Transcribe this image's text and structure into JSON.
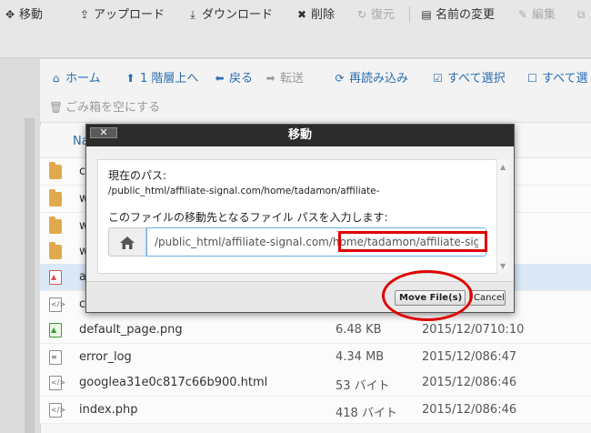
{
  "toolbar": {
    "items": [
      {
        "label": "移動",
        "icon": "move-icon",
        "glyph": "✥"
      },
      {
        "label": "アップロード",
        "icon": "upload-icon",
        "glyph": "⇪"
      },
      {
        "label": "ダウンロード",
        "icon": "download-icon",
        "glyph": "⤓"
      },
      {
        "label": "削除",
        "icon": "delete-icon",
        "glyph": "✖"
      },
      {
        "label": "復元",
        "icon": "restore-icon",
        "glyph": "↻",
        "disabled": true
      },
      {
        "label": "名前の変更",
        "icon": "rename-icon",
        "glyph": "▤"
      },
      {
        "label": "編集",
        "icon": "edit-icon",
        "glyph": "✎",
        "disabled": true
      },
      {
        "label": "",
        "icon": "overflow-icon",
        "glyph": "⧉",
        "disabled": true
      }
    ]
  },
  "subbar": {
    "items": [
      {
        "label": "ホーム",
        "icon": "home-icon",
        "glyph": "⌂"
      },
      {
        "label": "1 階層上へ",
        "icon": "level-up-icon",
        "glyph": "⬆"
      },
      {
        "label": "戻る",
        "icon": "back-icon",
        "glyph": "⬅"
      },
      {
        "label": "転送",
        "icon": "forward-icon",
        "glyph": "➡",
        "gray": true
      },
      {
        "label": "再読み込み",
        "icon": "reload-icon",
        "glyph": "⟳"
      },
      {
        "label": "すべて選択",
        "icon": "check-icon",
        "glyph": "☑"
      },
      {
        "label": "すべて選",
        "icon": "square-icon",
        "glyph": "☐"
      }
    ],
    "trash_label": "ごみ箱を空にする",
    "trash_glyph": "🗑"
  },
  "file_list": {
    "column_header": "Na",
    "rows": [
      {
        "type": "folder",
        "name": "c",
        "size": "",
        "date": ""
      },
      {
        "type": "folder",
        "name": "w",
        "size": "",
        "date": ""
      },
      {
        "type": "folder",
        "name": "w",
        "size": "",
        "date": ""
      },
      {
        "type": "folder",
        "name": "w",
        "size": "",
        "date": ""
      },
      {
        "type": "pdf",
        "name": "a",
        "size": "",
        "date": "",
        "selected": true
      },
      {
        "type": "code",
        "name": "c",
        "size": "",
        "date": ""
      },
      {
        "type": "image",
        "name": "default_page.png",
        "size": "6.48 KB",
        "date": "2015/12/0710:10"
      },
      {
        "type": "text",
        "name": "error_log",
        "size": "4.34 MB",
        "date": "2015/12/086:47"
      },
      {
        "type": "code",
        "name": "googlea31e0c817c66b900.html",
        "size": "53 バイト",
        "date": "2015/12/086:46"
      },
      {
        "type": "code",
        "name": "index.php",
        "size": "418 バイト",
        "date": "2015/12/086:46"
      }
    ]
  },
  "modal": {
    "title": "移動",
    "close_label": "✕",
    "current_path_label": "現在のパス:",
    "current_path_value": "/public_html/affiliate-signal.com/home/tadamon/affiliate-",
    "dest_label": "このファイルの移動先となるファイル パスを入力します:",
    "dest_value": "/public_html/affiliate-signal.com/home/tadamon/affiliate-sign",
    "move_button": "Move File(s)",
    "cancel_button": "Cancel"
  }
}
